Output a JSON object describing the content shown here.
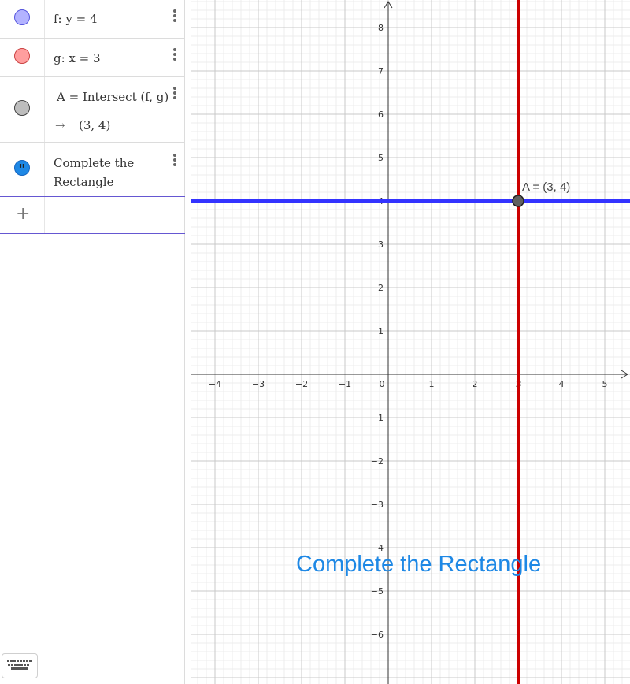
{
  "algebra": {
    "items": [
      {
        "label": "f: y = 4",
        "color": "#7a7aff"
      },
      {
        "label": "g: x = 3",
        "color": "#ff6666"
      },
      {
        "label": "A = Intersect (f, g)",
        "result": "(3, 4)",
        "arrow": "→",
        "color": "#8e8e8e"
      },
      {
        "label_line1": "Complete the",
        "label_line2": "Rectangle",
        "color": "#1e88e5"
      }
    ],
    "add_symbol": "+"
  },
  "graph": {
    "x_ticks": [
      "−4",
      "−3",
      "−2",
      "−1",
      "0",
      "1",
      "2",
      "3",
      "4",
      "5"
    ],
    "y_ticks_pos": [
      "1",
      "2",
      "3",
      "4",
      "5",
      "6",
      "7",
      "8"
    ],
    "y_ticks_neg": [
      "−1",
      "−2",
      "−3",
      "−4",
      "−5",
      "−6"
    ],
    "point_label": "A = (3, 4)",
    "text_object": "Complete the Rectangle",
    "line_f_color": "#3333ff",
    "line_g_color": "#cc0000"
  }
}
